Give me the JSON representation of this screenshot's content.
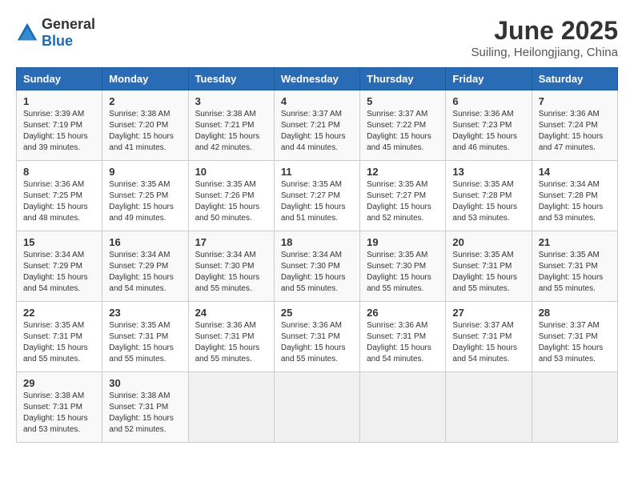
{
  "logo": {
    "general": "General",
    "blue": "Blue"
  },
  "title": "June 2025",
  "subtitle": "Suiling, Heilongjiang, China",
  "weekdays": [
    "Sunday",
    "Monday",
    "Tuesday",
    "Wednesday",
    "Thursday",
    "Friday",
    "Saturday"
  ],
  "weeks": [
    [
      {
        "day": "1",
        "info": "Sunrise: 3:39 AM\nSunset: 7:19 PM\nDaylight: 15 hours\nand 39 minutes."
      },
      {
        "day": "2",
        "info": "Sunrise: 3:38 AM\nSunset: 7:20 PM\nDaylight: 15 hours\nand 41 minutes."
      },
      {
        "day": "3",
        "info": "Sunrise: 3:38 AM\nSunset: 7:21 PM\nDaylight: 15 hours\nand 42 minutes."
      },
      {
        "day": "4",
        "info": "Sunrise: 3:37 AM\nSunset: 7:21 PM\nDaylight: 15 hours\nand 44 minutes."
      },
      {
        "day": "5",
        "info": "Sunrise: 3:37 AM\nSunset: 7:22 PM\nDaylight: 15 hours\nand 45 minutes."
      },
      {
        "day": "6",
        "info": "Sunrise: 3:36 AM\nSunset: 7:23 PM\nDaylight: 15 hours\nand 46 minutes."
      },
      {
        "day": "7",
        "info": "Sunrise: 3:36 AM\nSunset: 7:24 PM\nDaylight: 15 hours\nand 47 minutes."
      }
    ],
    [
      {
        "day": "8",
        "info": "Sunrise: 3:36 AM\nSunset: 7:25 PM\nDaylight: 15 hours\nand 48 minutes."
      },
      {
        "day": "9",
        "info": "Sunrise: 3:35 AM\nSunset: 7:25 PM\nDaylight: 15 hours\nand 49 minutes."
      },
      {
        "day": "10",
        "info": "Sunrise: 3:35 AM\nSunset: 7:26 PM\nDaylight: 15 hours\nand 50 minutes."
      },
      {
        "day": "11",
        "info": "Sunrise: 3:35 AM\nSunset: 7:27 PM\nDaylight: 15 hours\nand 51 minutes."
      },
      {
        "day": "12",
        "info": "Sunrise: 3:35 AM\nSunset: 7:27 PM\nDaylight: 15 hours\nand 52 minutes."
      },
      {
        "day": "13",
        "info": "Sunrise: 3:35 AM\nSunset: 7:28 PM\nDaylight: 15 hours\nand 53 minutes."
      },
      {
        "day": "14",
        "info": "Sunrise: 3:34 AM\nSunset: 7:28 PM\nDaylight: 15 hours\nand 53 minutes."
      }
    ],
    [
      {
        "day": "15",
        "info": "Sunrise: 3:34 AM\nSunset: 7:29 PM\nDaylight: 15 hours\nand 54 minutes."
      },
      {
        "day": "16",
        "info": "Sunrise: 3:34 AM\nSunset: 7:29 PM\nDaylight: 15 hours\nand 54 minutes."
      },
      {
        "day": "17",
        "info": "Sunrise: 3:34 AM\nSunset: 7:30 PM\nDaylight: 15 hours\nand 55 minutes."
      },
      {
        "day": "18",
        "info": "Sunrise: 3:34 AM\nSunset: 7:30 PM\nDaylight: 15 hours\nand 55 minutes."
      },
      {
        "day": "19",
        "info": "Sunrise: 3:35 AM\nSunset: 7:30 PM\nDaylight: 15 hours\nand 55 minutes."
      },
      {
        "day": "20",
        "info": "Sunrise: 3:35 AM\nSunset: 7:31 PM\nDaylight: 15 hours\nand 55 minutes."
      },
      {
        "day": "21",
        "info": "Sunrise: 3:35 AM\nSunset: 7:31 PM\nDaylight: 15 hours\nand 55 minutes."
      }
    ],
    [
      {
        "day": "22",
        "info": "Sunrise: 3:35 AM\nSunset: 7:31 PM\nDaylight: 15 hours\nand 55 minutes."
      },
      {
        "day": "23",
        "info": "Sunrise: 3:35 AM\nSunset: 7:31 PM\nDaylight: 15 hours\nand 55 minutes."
      },
      {
        "day": "24",
        "info": "Sunrise: 3:36 AM\nSunset: 7:31 PM\nDaylight: 15 hours\nand 55 minutes."
      },
      {
        "day": "25",
        "info": "Sunrise: 3:36 AM\nSunset: 7:31 PM\nDaylight: 15 hours\nand 55 minutes."
      },
      {
        "day": "26",
        "info": "Sunrise: 3:36 AM\nSunset: 7:31 PM\nDaylight: 15 hours\nand 54 minutes."
      },
      {
        "day": "27",
        "info": "Sunrise: 3:37 AM\nSunset: 7:31 PM\nDaylight: 15 hours\nand 54 minutes."
      },
      {
        "day": "28",
        "info": "Sunrise: 3:37 AM\nSunset: 7:31 PM\nDaylight: 15 hours\nand 53 minutes."
      }
    ],
    [
      {
        "day": "29",
        "info": "Sunrise: 3:38 AM\nSunset: 7:31 PM\nDaylight: 15 hours\nand 53 minutes."
      },
      {
        "day": "30",
        "info": "Sunrise: 3:38 AM\nSunset: 7:31 PM\nDaylight: 15 hours\nand 52 minutes."
      },
      {
        "day": "",
        "info": ""
      },
      {
        "day": "",
        "info": ""
      },
      {
        "day": "",
        "info": ""
      },
      {
        "day": "",
        "info": ""
      },
      {
        "day": "",
        "info": ""
      }
    ]
  ]
}
